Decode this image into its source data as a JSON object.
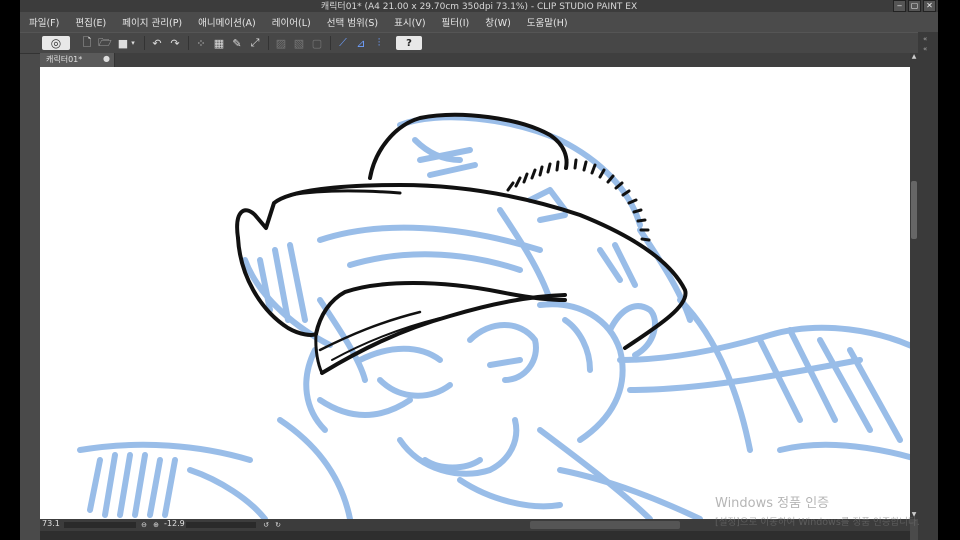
{
  "window": {
    "title": "캐릭터01* (A4 21.00 x 29.70cm 350dpi 73.1%) - CLIP STUDIO PAINT EX",
    "buttons": [
      "‒",
      "▢",
      "✕"
    ]
  },
  "menu": [
    "파일(F)",
    "편집(E)",
    "페이지 관리(P)",
    "애니메이션(A)",
    "레이어(L)",
    "선택 범위(S)",
    "표시(V)",
    "필터(I)",
    "창(W)",
    "도움말(H)"
  ],
  "toolbar": {
    "icons": [
      "app-logo-icon",
      "new-file-icon",
      "open-folder-icon",
      "save-icon",
      "undo-icon",
      "redo-icon",
      "deselect-icon",
      "select-all-icon",
      "fill-icon",
      "transform-icon",
      "snap-ruler-icon",
      "snap-grid-icon",
      "snap-special-icon",
      "help-icon"
    ],
    "help_label": "?"
  },
  "tab": {
    "label": "캐릭터01*",
    "close": "●"
  },
  "status": {
    "zoom": "73.1",
    "angle": "-12.9"
  },
  "watermark": {
    "line1": "Windows 정품 인증",
    "line2": "[설정]으로 이동하여 Windows를 정품 인증합니다."
  },
  "colors": {
    "sketch_blue": "#8fb6e6",
    "ink": "#111111",
    "canvas": "#ffffff",
    "ui_dark": "#4a4a4a"
  }
}
